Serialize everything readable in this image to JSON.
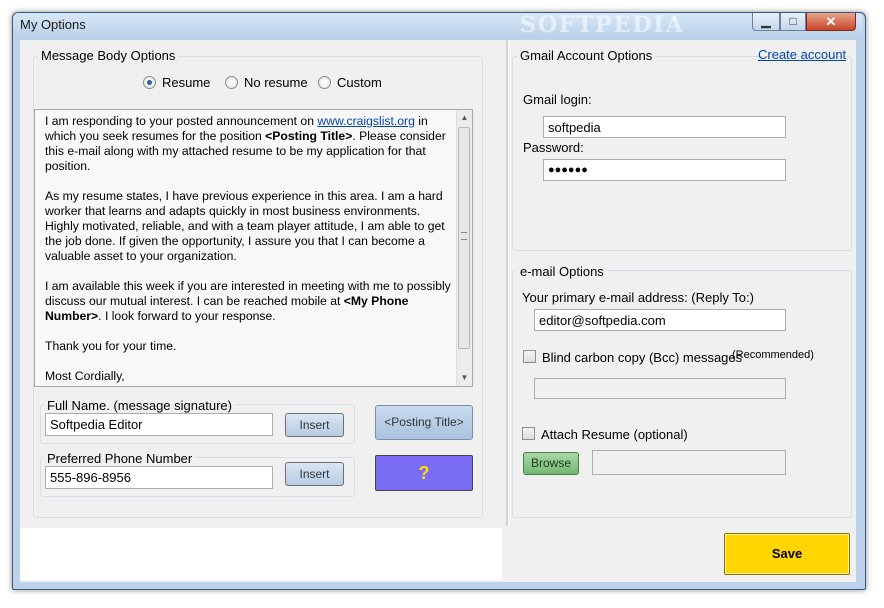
{
  "window": {
    "title": "My Options",
    "watermark": "SOFTPEDIA"
  },
  "message_body": {
    "group_title": "Message Body Options",
    "radio": [
      {
        "label": "Resume",
        "checked": true
      },
      {
        "label": "No resume",
        "checked": false
      },
      {
        "label": "Custom",
        "checked": false
      }
    ],
    "paragraphs": [
      {
        "before": "I am responding to your posted announcement on ",
        "link": "www.craigslist.org",
        "mid": " in which you seek resumes for the position ",
        "bold": "<Posting Title>",
        "after": ". Please consider this e-mail along with my attached resume to be my application for that position."
      },
      {
        "text": "As my resume states, I have previous experience in this area. I am a hard worker that learns and adapts quickly in most business environments. Highly motivated, reliable, and with a team player attitude, I am able to get the job done. If given the opportunity, I assure you that I can become a valuable asset to your organization."
      },
      {
        "before": "I am available this week if you are interested in meeting with me to possibly discuss our mutual interest. I can be reached mobile at ",
        "bold": "<My Phone Number>",
        "after": ". I look forward to your response."
      },
      {
        "text": "Thank you for your time."
      },
      {
        "text": "Most Cordially,"
      }
    ],
    "full_name": {
      "label": "Full Name. (message signature)",
      "value": "Softpedia Editor",
      "insert_label": "Insert"
    },
    "phone": {
      "label": "Preferred Phone Number",
      "value": "555-896-8956",
      "insert_label": "Insert"
    },
    "posting_title_button": "<Posting Title>",
    "help_button": "?"
  },
  "gmail": {
    "group_title": "Gmail Account Options",
    "create_account": "Create account",
    "login_label": "Gmail login:",
    "login_value": "softpedia",
    "password_label": "Password:",
    "password_value": "●●●●●●"
  },
  "email": {
    "group_title": "e-mail Options",
    "primary_label": "Your primary e-mail address: (Reply To:)",
    "primary_value": "editor@softpedia.com",
    "bcc_label": "Blind carbon copy (Bcc) messages",
    "bcc_note": "(Recommended)",
    "bcc_value": "",
    "attach_label": "Attach Resume (optional)",
    "browse_label": "Browse",
    "attach_value": ""
  },
  "save_label": "Save",
  "colors": {
    "help_button": "#7b6cf6",
    "save_button": "#ffd600",
    "browse_button": "#8cc48c",
    "link": "#0645ad"
  }
}
